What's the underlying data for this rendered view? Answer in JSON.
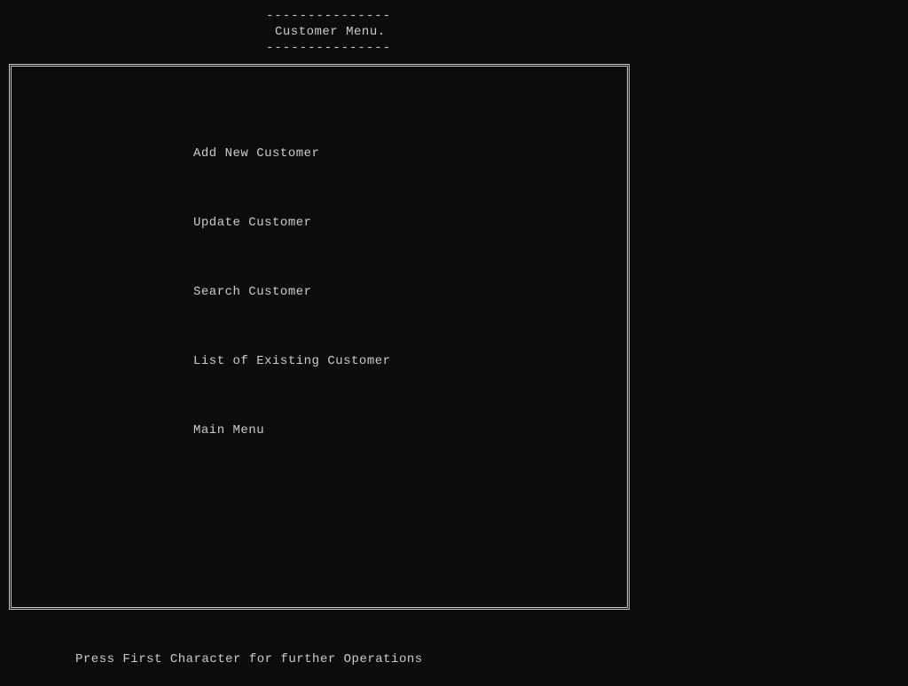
{
  "header": {
    "dash_line": "---------------",
    "title": "Customer Menu."
  },
  "menu": {
    "items": [
      "Add New Customer",
      "Update Customer",
      "Search Customer",
      "List of Existing Customer",
      "Main Menu"
    ]
  },
  "footer": {
    "hint": "Press First Character for further Operations"
  }
}
